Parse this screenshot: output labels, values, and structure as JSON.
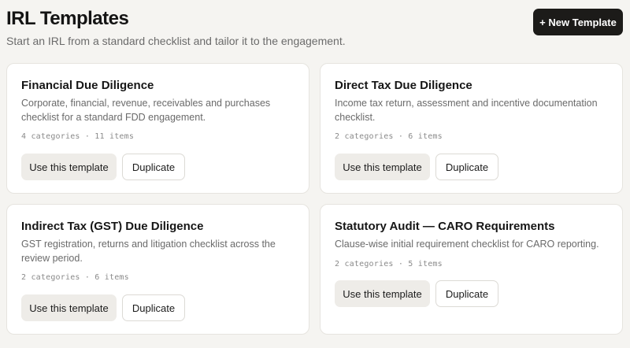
{
  "header": {
    "title": "IRL Templates",
    "subtitle": "Start an IRL from a standard checklist and tailor it to the engagement.",
    "new_button_label": "+ New Template"
  },
  "actions": {
    "use_label": "Use this template",
    "duplicate_label": "Duplicate"
  },
  "templates": [
    {
      "title": "Financial Due Diligence",
      "description": "Corporate, financial, revenue, receivables and purchases checklist for a standard FDD engagement.",
      "meta": "4 categories · 11 items"
    },
    {
      "title": "Direct Tax Due Diligence",
      "description": "Income tax return, assessment and incentive documentation checklist.",
      "meta": "2 categories · 6 items"
    },
    {
      "title": "Indirect Tax (GST) Due Diligence",
      "description": "GST registration, returns and litigation checklist across the review period.",
      "meta": "2 categories · 6 items"
    },
    {
      "title": "Statutory Audit — CARO Requirements",
      "description": "Clause-wise initial requirement checklist for CARO reporting.",
      "meta": "2 categories · 5 items"
    }
  ]
}
